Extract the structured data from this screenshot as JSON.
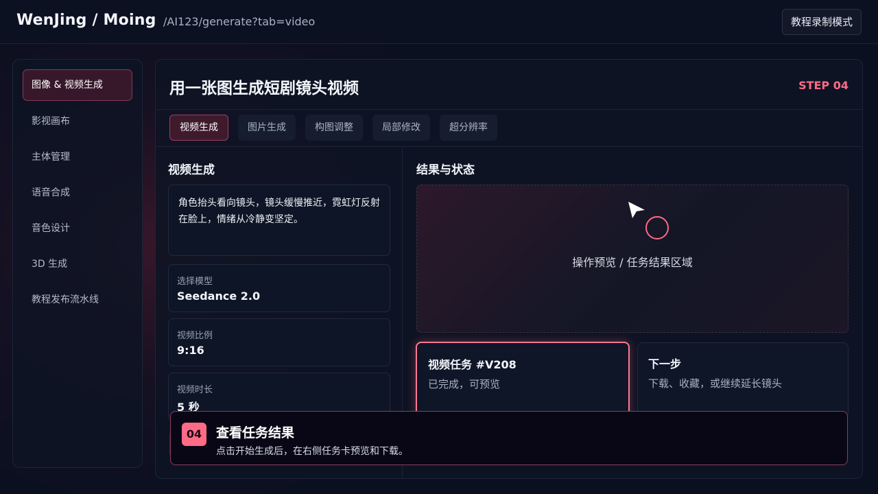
{
  "header": {
    "brand": "WenJing / Moing",
    "path": "/AI123/generate?tab=video",
    "mode_button": "教程录制模式"
  },
  "sidebar": {
    "items": [
      {
        "label": "图像 & 视频生成",
        "active": true
      },
      {
        "label": "影视画布",
        "active": false
      },
      {
        "label": "主体管理",
        "active": false
      },
      {
        "label": "语音合成",
        "active": false
      },
      {
        "label": "音色设计",
        "active": false
      },
      {
        "label": "3D 生成",
        "active": false
      },
      {
        "label": "教程发布流水线",
        "active": false
      }
    ]
  },
  "main": {
    "title": "用一张图生成短剧镜头视频",
    "step": "STEP 04",
    "tabs": [
      {
        "label": "视频生成",
        "active": true
      },
      {
        "label": "图片生成",
        "active": false
      },
      {
        "label": "构图调整",
        "active": false
      },
      {
        "label": "局部修改",
        "active": false
      },
      {
        "label": "超分辨率",
        "active": false
      }
    ]
  },
  "left_panel": {
    "title": "视频生成",
    "prompt": "角色抬头看向镜头，镜头缓慢推近，霓虹灯反射在脸上，情绪从冷静变坚定。",
    "fields": [
      {
        "label": "选择模型",
        "value": "Seedance 2.0"
      },
      {
        "label": "视频比例",
        "value": "9:16"
      },
      {
        "label": "视频时长",
        "value": "5 秒"
      }
    ]
  },
  "right_panel": {
    "title": "结果与状态",
    "preview_text": "操作预览 / 任务结果区域",
    "task": {
      "title": "视频任务 #V208",
      "status": "已完成，可预览"
    },
    "next": {
      "title": "下一步",
      "desc": "下载、收藏，或继续延长镜头"
    }
  },
  "callout": {
    "step": "04",
    "title": "查看任务结果",
    "desc": "点击开始生成后，在右侧任务卡预览和下载。"
  },
  "colors": {
    "accent": "#ff6b86",
    "background": "#0b1020",
    "panel": "#0e1424"
  },
  "icons": {
    "cursor": "cursor-arrow-icon",
    "click_indicator": "click-ring-icon"
  }
}
